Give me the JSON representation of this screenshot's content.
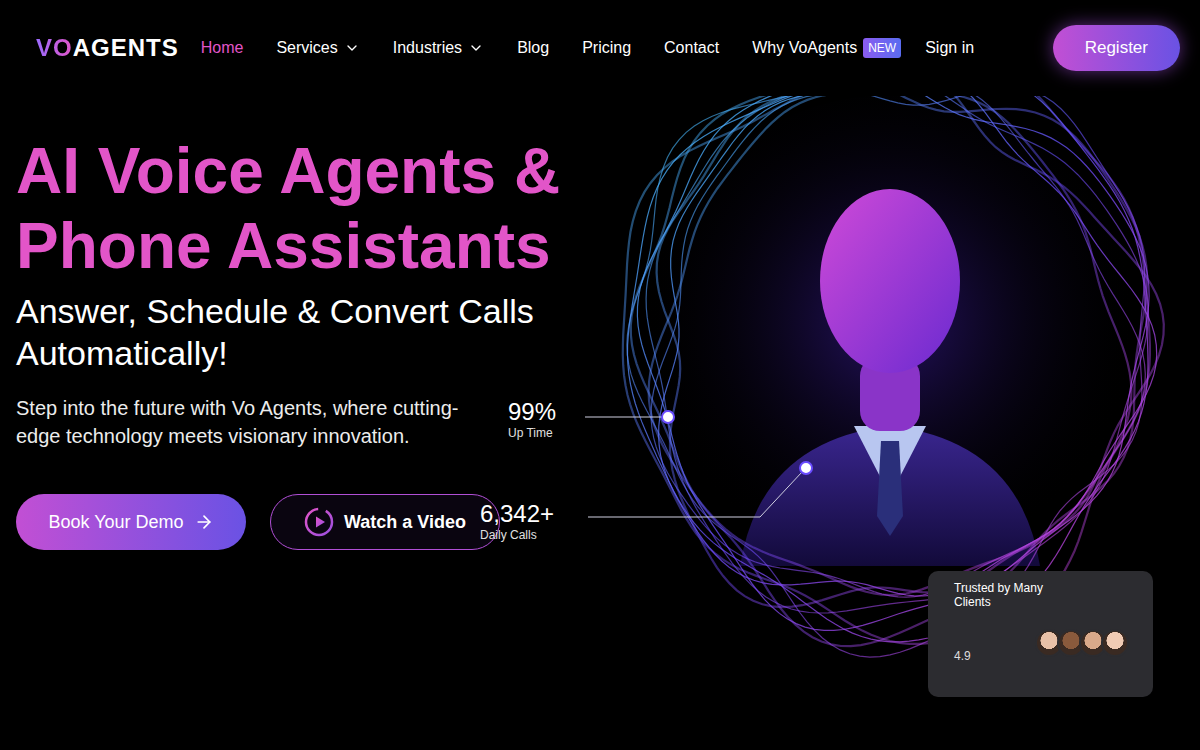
{
  "logo": {
    "mark": "VO",
    "name": "AGENTS"
  },
  "nav": {
    "items": [
      {
        "label": "Home",
        "selected": true,
        "kind": "link"
      },
      {
        "label": "Services",
        "selected": false,
        "kind": "menu"
      },
      {
        "label": "Industries",
        "selected": false,
        "kind": "menu"
      },
      {
        "label": "Blog",
        "selected": false,
        "kind": "link"
      },
      {
        "label": "Pricing",
        "selected": false,
        "kind": "link"
      },
      {
        "label": "Contact",
        "selected": false,
        "kind": "link"
      },
      {
        "label": "Why VoAgents",
        "selected": false,
        "kind": "link",
        "badge": "NEW"
      }
    ],
    "sign_in": "Sign in",
    "register": "Register"
  },
  "hero": {
    "title_lines": [
      "AI Voice Agents &",
      "Phone Assistants"
    ],
    "subtitle_lines": [
      "Answer, Schedule & Convert Calls",
      "Automatically!"
    ],
    "description": "Step into the future with Vo Agents, where cutting-edge technology meets visionary innovation.",
    "buttons": [
      {
        "label": "Book Your Demo",
        "kind": "primary"
      },
      {
        "label": "Watch a Video",
        "kind": "secondary"
      }
    ],
    "stats": [
      {
        "value": "99%",
        "label": "Up Time"
      },
      {
        "value": "6,342+",
        "label": "Daily Calls"
      }
    ],
    "trust": {
      "title": "Trusted by Many Clients",
      "rating": "4.9"
    }
  }
}
